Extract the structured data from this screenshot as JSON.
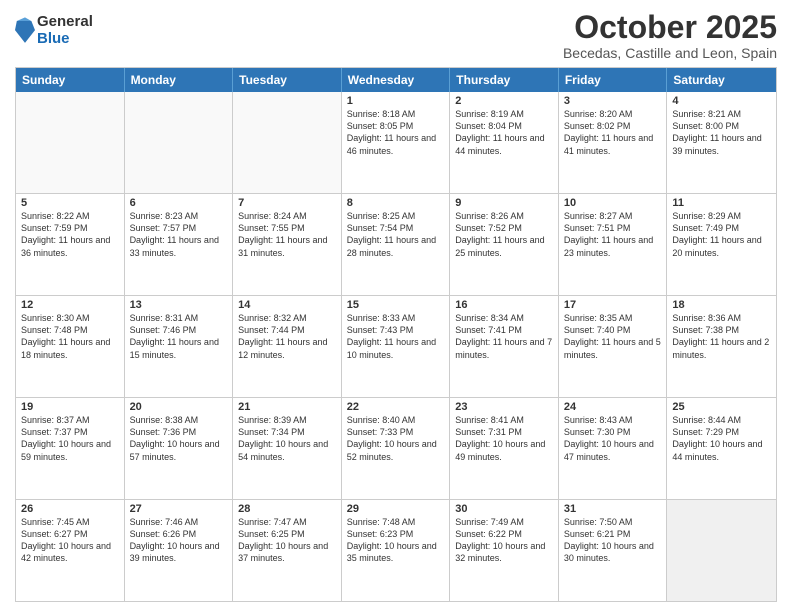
{
  "logo": {
    "general": "General",
    "blue": "Blue"
  },
  "title": {
    "month": "October 2025",
    "location": "Becedas, Castille and Leon, Spain"
  },
  "days": [
    "Sunday",
    "Monday",
    "Tuesday",
    "Wednesday",
    "Thursday",
    "Friday",
    "Saturday"
  ],
  "weeks": [
    [
      {
        "day": "",
        "text": ""
      },
      {
        "day": "",
        "text": ""
      },
      {
        "day": "",
        "text": ""
      },
      {
        "day": "1",
        "text": "Sunrise: 8:18 AM\nSunset: 8:05 PM\nDaylight: 11 hours\nand 46 minutes."
      },
      {
        "day": "2",
        "text": "Sunrise: 8:19 AM\nSunset: 8:04 PM\nDaylight: 11 hours\nand 44 minutes."
      },
      {
        "day": "3",
        "text": "Sunrise: 8:20 AM\nSunset: 8:02 PM\nDaylight: 11 hours\nand 41 minutes."
      },
      {
        "day": "4",
        "text": "Sunrise: 8:21 AM\nSunset: 8:00 PM\nDaylight: 11 hours\nand 39 minutes."
      }
    ],
    [
      {
        "day": "5",
        "text": "Sunrise: 8:22 AM\nSunset: 7:59 PM\nDaylight: 11 hours\nand 36 minutes."
      },
      {
        "day": "6",
        "text": "Sunrise: 8:23 AM\nSunset: 7:57 PM\nDaylight: 11 hours\nand 33 minutes."
      },
      {
        "day": "7",
        "text": "Sunrise: 8:24 AM\nSunset: 7:55 PM\nDaylight: 11 hours\nand 31 minutes."
      },
      {
        "day": "8",
        "text": "Sunrise: 8:25 AM\nSunset: 7:54 PM\nDaylight: 11 hours\nand 28 minutes."
      },
      {
        "day": "9",
        "text": "Sunrise: 8:26 AM\nSunset: 7:52 PM\nDaylight: 11 hours\nand 25 minutes."
      },
      {
        "day": "10",
        "text": "Sunrise: 8:27 AM\nSunset: 7:51 PM\nDaylight: 11 hours\nand 23 minutes."
      },
      {
        "day": "11",
        "text": "Sunrise: 8:29 AM\nSunset: 7:49 PM\nDaylight: 11 hours\nand 20 minutes."
      }
    ],
    [
      {
        "day": "12",
        "text": "Sunrise: 8:30 AM\nSunset: 7:48 PM\nDaylight: 11 hours\nand 18 minutes."
      },
      {
        "day": "13",
        "text": "Sunrise: 8:31 AM\nSunset: 7:46 PM\nDaylight: 11 hours\nand 15 minutes."
      },
      {
        "day": "14",
        "text": "Sunrise: 8:32 AM\nSunset: 7:44 PM\nDaylight: 11 hours\nand 12 minutes."
      },
      {
        "day": "15",
        "text": "Sunrise: 8:33 AM\nSunset: 7:43 PM\nDaylight: 11 hours\nand 10 minutes."
      },
      {
        "day": "16",
        "text": "Sunrise: 8:34 AM\nSunset: 7:41 PM\nDaylight: 11 hours\nand 7 minutes."
      },
      {
        "day": "17",
        "text": "Sunrise: 8:35 AM\nSunset: 7:40 PM\nDaylight: 11 hours\nand 5 minutes."
      },
      {
        "day": "18",
        "text": "Sunrise: 8:36 AM\nSunset: 7:38 PM\nDaylight: 11 hours\nand 2 minutes."
      }
    ],
    [
      {
        "day": "19",
        "text": "Sunrise: 8:37 AM\nSunset: 7:37 PM\nDaylight: 10 hours\nand 59 minutes."
      },
      {
        "day": "20",
        "text": "Sunrise: 8:38 AM\nSunset: 7:36 PM\nDaylight: 10 hours\nand 57 minutes."
      },
      {
        "day": "21",
        "text": "Sunrise: 8:39 AM\nSunset: 7:34 PM\nDaylight: 10 hours\nand 54 minutes."
      },
      {
        "day": "22",
        "text": "Sunrise: 8:40 AM\nSunset: 7:33 PM\nDaylight: 10 hours\nand 52 minutes."
      },
      {
        "day": "23",
        "text": "Sunrise: 8:41 AM\nSunset: 7:31 PM\nDaylight: 10 hours\nand 49 minutes."
      },
      {
        "day": "24",
        "text": "Sunrise: 8:43 AM\nSunset: 7:30 PM\nDaylight: 10 hours\nand 47 minutes."
      },
      {
        "day": "25",
        "text": "Sunrise: 8:44 AM\nSunset: 7:29 PM\nDaylight: 10 hours\nand 44 minutes."
      }
    ],
    [
      {
        "day": "26",
        "text": "Sunrise: 7:45 AM\nSunset: 6:27 PM\nDaylight: 10 hours\nand 42 minutes."
      },
      {
        "day": "27",
        "text": "Sunrise: 7:46 AM\nSunset: 6:26 PM\nDaylight: 10 hours\nand 39 minutes."
      },
      {
        "day": "28",
        "text": "Sunrise: 7:47 AM\nSunset: 6:25 PM\nDaylight: 10 hours\nand 37 minutes."
      },
      {
        "day": "29",
        "text": "Sunrise: 7:48 AM\nSunset: 6:23 PM\nDaylight: 10 hours\nand 35 minutes."
      },
      {
        "day": "30",
        "text": "Sunrise: 7:49 AM\nSunset: 6:22 PM\nDaylight: 10 hours\nand 32 minutes."
      },
      {
        "day": "31",
        "text": "Sunrise: 7:50 AM\nSunset: 6:21 PM\nDaylight: 10 hours\nand 30 minutes."
      },
      {
        "day": "",
        "text": ""
      }
    ]
  ]
}
